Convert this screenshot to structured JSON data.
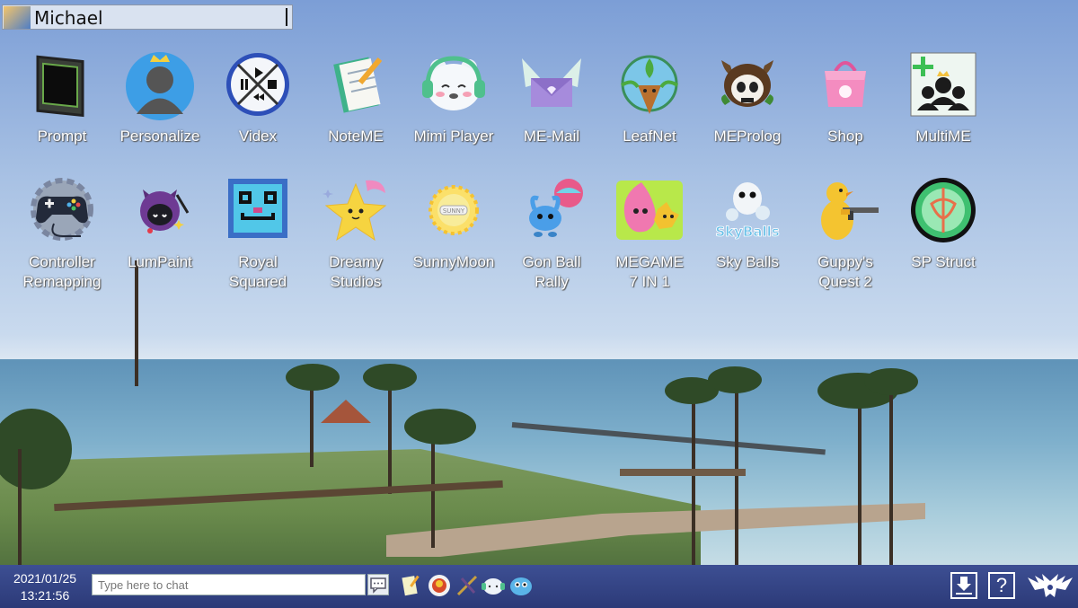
{
  "user": {
    "name": "Michael"
  },
  "apps": [
    {
      "label": "Prompt",
      "icon": "terminal-icon"
    },
    {
      "label": "Personalize",
      "icon": "profile-crown-icon"
    },
    {
      "label": "Videx",
      "icon": "media-controls-icon"
    },
    {
      "label": "NoteME",
      "icon": "notepad-pencil-icon"
    },
    {
      "label": "Mimi Player",
      "icon": "bear-headphones-icon"
    },
    {
      "label": "ME-Mail",
      "icon": "winged-envelope-icon"
    },
    {
      "label": "LeafNet",
      "icon": "globe-sprout-icon"
    },
    {
      "label": "MEProlog",
      "icon": "horned-skull-icon"
    },
    {
      "label": "Shop",
      "icon": "shopping-bag-icon"
    },
    {
      "label": "MultiME",
      "icon": "group-add-icon"
    },
    {
      "label": "Controller\nRemapping",
      "icon": "gamepad-gear-icon"
    },
    {
      "label": "LumPaint",
      "icon": "cat-brush-icon"
    },
    {
      "label": "Royal\nSquared",
      "icon": "pixel-face-icon"
    },
    {
      "label": "Dreamy\nStudios",
      "icon": "star-character-icon"
    },
    {
      "label": "SunnyMoon",
      "icon": "sun-moon-icon"
    },
    {
      "label": "Gon Ball\nRally",
      "icon": "blue-creature-ball-icon"
    },
    {
      "label": "MEGAME\n7 IN 1",
      "icon": "pink-blob-icon"
    },
    {
      "label": "Sky Balls",
      "icon": "sky-balls-icon"
    },
    {
      "label": "Guppy's\nQuest 2",
      "icon": "duck-gun-icon"
    },
    {
      "label": "SP Struct",
      "icon": "green-orb-icon"
    }
  ],
  "taskbar": {
    "date": "2021/01/25",
    "time": "13:21:56",
    "chat_placeholder": "Type here to chat",
    "tray_icons": [
      "noteme-tray-icon",
      "character-tray-icon",
      "sword-tray-icon",
      "bear-tray-icon",
      "blue-creature-tray-icon"
    ],
    "help_label": "?"
  },
  "colors": {
    "taskbar": "#33428a",
    "label_text": "#ffffff"
  }
}
